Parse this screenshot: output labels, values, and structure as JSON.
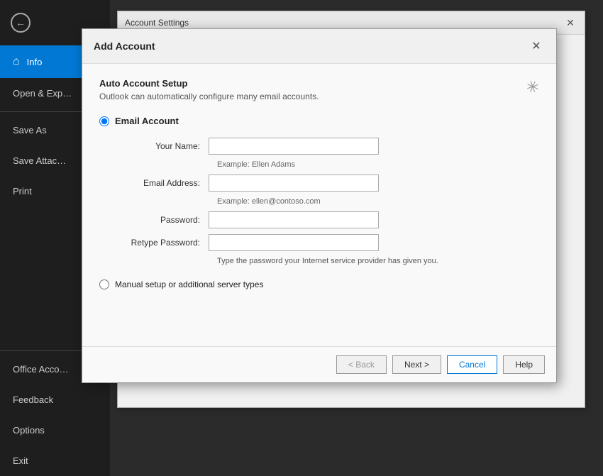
{
  "sidebar": {
    "back_icon": "←",
    "items": [
      {
        "id": "info",
        "label": "Info",
        "active": true,
        "icon": "⌂"
      },
      {
        "id": "open-export",
        "label": "Open & Exp…",
        "active": false
      },
      {
        "id": "save-as",
        "label": "Save As",
        "active": false
      },
      {
        "id": "save-attachments",
        "label": "Save Attac…",
        "active": false
      },
      {
        "id": "print",
        "label": "Print",
        "active": false
      },
      {
        "id": "office-account",
        "label": "Office Acco…",
        "active": false
      },
      {
        "id": "feedback",
        "label": "Feedback",
        "active": false
      },
      {
        "id": "options",
        "label": "Options",
        "active": false
      },
      {
        "id": "exit",
        "label": "Exit",
        "active": false
      }
    ]
  },
  "account_settings_window": {
    "title": "Account Settings",
    "close_icon": "✕"
  },
  "dialog": {
    "title": "Add Account",
    "close_icon": "✕",
    "auto_setup": {
      "heading": "Auto Account Setup",
      "description": "Outlook can automatically configure many email accounts."
    },
    "email_radio_label": "Email Account",
    "fields": [
      {
        "id": "your-name",
        "label": "Your Name:",
        "placeholder": "",
        "hint": "Example: Ellen Adams"
      },
      {
        "id": "email-address",
        "label": "Email Address:",
        "placeholder": "",
        "hint": "Example: ellen@contoso.com"
      },
      {
        "id": "password",
        "label": "Password:",
        "placeholder": ""
      },
      {
        "id": "retype-password",
        "label": "Retype Password:",
        "placeholder": ""
      }
    ],
    "password_note": "Type the password your Internet service provider has given you.",
    "manual_setup_label": "Manual setup or additional server types",
    "buttons": {
      "back": "< Back",
      "next": "Next >",
      "cancel": "Cancel",
      "help": "Help"
    }
  }
}
